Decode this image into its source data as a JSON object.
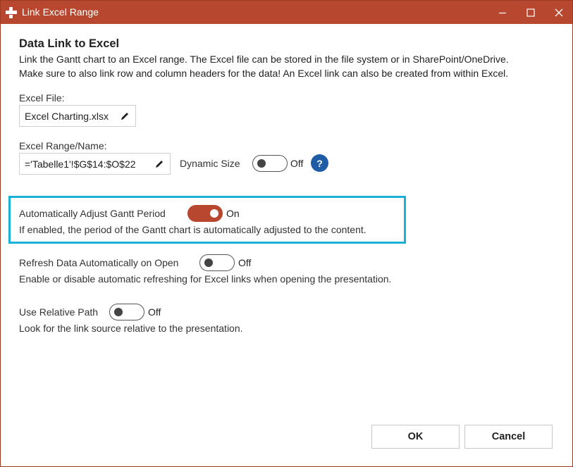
{
  "window": {
    "title": "Link Excel Range",
    "accent_color": "#b8472f",
    "highlight_color": "#1ab0d8",
    "help_color": "#1f5ca6"
  },
  "header": {
    "title": "Data Link to Excel",
    "description_line1": "Link the Gantt chart to an Excel range. The Excel file can be stored in the file system or in SharePoint/OneDrive.",
    "description_line2": "Make sure to also link row and column headers for the data! An Excel link can also be created from within Excel."
  },
  "excel_file": {
    "label": "Excel File:",
    "value": "Excel Charting.xlsx",
    "edit_icon": "pencil-icon"
  },
  "excel_range": {
    "label": "Excel Range/Name:",
    "value": "='Tabelle1'!$G$14:$O$22",
    "edit_icon": "pencil-icon",
    "dynamic_size_label": "Dynamic Size",
    "dynamic_size_state": "Off",
    "help_label": "?"
  },
  "auto_adjust": {
    "label": "Automatically Adjust Gantt Period",
    "state": "On",
    "description": "If enabled, the period of the Gantt chart is automatically adjusted to the content."
  },
  "refresh_on_open": {
    "label": "Refresh Data Automatically on Open",
    "state": "Off",
    "description": "Enable or disable automatic refreshing for Excel links when opening the presentation."
  },
  "relative_path": {
    "label": "Use Relative Path",
    "state": "Off",
    "description": "Look for the link source relative to the presentation."
  },
  "buttons": {
    "ok": "OK",
    "cancel": "Cancel"
  }
}
